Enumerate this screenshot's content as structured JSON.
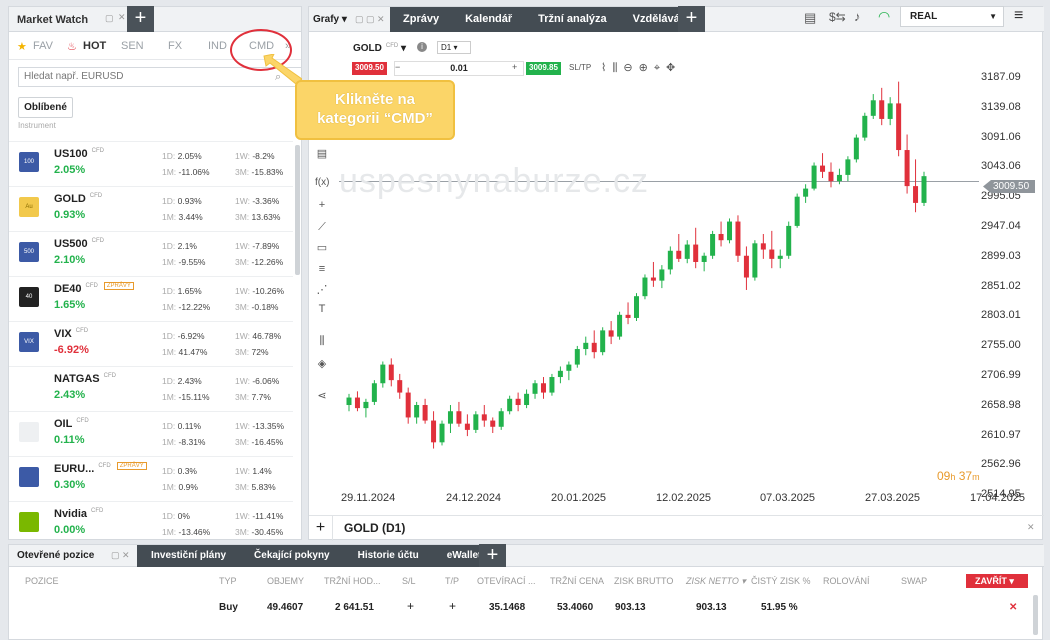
{
  "market_watch": {
    "title": "Market Watch",
    "categories": [
      "FAV",
      "HOT",
      "SEN",
      "FX",
      "IND",
      "CMD"
    ],
    "search_placeholder": "Hledat např. EURUSD",
    "favorites_button": "Oblíbené",
    "instrument_label": "Instrument",
    "cfd_tag": "CFD",
    "rows": [
      {
        "symbol": "US100",
        "change": "2.05%",
        "d1": "2.05%",
        "m1": "-11.06%",
        "w1": "-8.2%",
        "m3": "-15.83%",
        "badge": "",
        "flag_text": "100",
        "dir": "pos"
      },
      {
        "symbol": "GOLD",
        "change": "0.93%",
        "d1": "0.93%",
        "m1": "3.44%",
        "w1": "-3.36%",
        "m3": "13.63%",
        "badge": "",
        "flag_text": "Au",
        "dir": "pos"
      },
      {
        "symbol": "US500",
        "change": "2.10%",
        "d1": "2.1%",
        "m1": "-9.55%",
        "w1": "-7.89%",
        "m3": "-12.26%",
        "badge": "",
        "flag_text": "500",
        "dir": "pos"
      },
      {
        "symbol": "DE40",
        "change": "1.65%",
        "d1": "1.65%",
        "m1": "-12.22%",
        "w1": "-10.26%",
        "m3": "-0.18%",
        "badge": "ZPRÁVY",
        "flag_text": "40",
        "dir": "pos"
      },
      {
        "symbol": "VIX",
        "change": "-6.92%",
        "d1": "-6.92%",
        "m1": "41.47%",
        "w1": "46.78%",
        "m3": "72%",
        "badge": "",
        "flag_text": "VIX",
        "dir": "neg"
      },
      {
        "symbol": "NATGAS",
        "change": "2.43%",
        "d1": "2.43%",
        "m1": "-15.11%",
        "w1": "-6.06%",
        "m3": "7.7%",
        "badge": "",
        "flag_text": "",
        "dir": "pos"
      },
      {
        "symbol": "OIL",
        "change": "0.11%",
        "d1": "0.11%",
        "m1": "-8.31%",
        "w1": "-13.35%",
        "m3": "-16.45%",
        "badge": "",
        "flag_text": "",
        "dir": "pos"
      },
      {
        "symbol": "EURU...",
        "change": "0.30%",
        "d1": "0.3%",
        "m1": "0.9%",
        "w1": "1.4%",
        "m3": "5.83%",
        "badge": "ZPRÁVY",
        "flag_text": "",
        "dir": "pos"
      },
      {
        "symbol": "Nvidia",
        "change": "0.00%",
        "d1": "0%",
        "m1": "-13.46%",
        "w1": "-11.41%",
        "m3": "-30.45%",
        "badge": "",
        "flag_text": "",
        "dir": "pos"
      }
    ],
    "stat_labels": {
      "d1": "1D:",
      "m1": "1M:",
      "w1": "1W:",
      "m3": "3M:"
    }
  },
  "chart_panel": {
    "tab_grafy": "Grafy",
    "tabs": [
      "Zprávy",
      "Kalendář",
      "Tržní analýza",
      "Vzdělávání"
    ],
    "symbol": "GOLD",
    "timeframe": "D1",
    "sell_price": "3009.50",
    "buy_price": "3009.85",
    "volume": "0.01",
    "sltp": "SL/TP",
    "watermark": "uspesnynaburze.cz",
    "current_price_label": "3009.50",
    "countdown_h": "09",
    "countdown_m": "37",
    "bottom_title": "GOLD (D1)",
    "price_axis": [
      "3187.09",
      "3139.08",
      "3091.06",
      "3043.06",
      "2995.05",
      "2947.04",
      "2899.03",
      "2851.02",
      "2803.01",
      "2755.00",
      "2706.99",
      "2658.98",
      "2610.97",
      "2562.96",
      "2514.95"
    ],
    "date_axis": [
      "29.11.2024",
      "24.12.2024",
      "20.01.2025",
      "12.02.2025",
      "07.03.2025",
      "27.03.2025",
      "17.04.2025"
    ]
  },
  "account": {
    "mode": "REAL"
  },
  "callout": {
    "line1": "Klikněte na",
    "line2": "kategorii “CMD”"
  },
  "bottom_panel": {
    "title": "Otevřené pozice",
    "tabs": [
      "Investiční plány",
      "Čekající pokyny",
      "Historie účtu",
      "eWallet"
    ],
    "columns": [
      "POZICE",
      "TYP",
      "OBJEMY",
      "TRŽNÍ HOD...",
      "S/L",
      "T/P",
      "OTEVÍRACÍ ...",
      "TRŽNÍ CENA",
      "ZISK BRUTTO",
      "ZISK NETTO",
      "ČISTÝ ZISK %",
      "ROLOVÁNÍ",
      "SWAP"
    ],
    "close_button": "ZAVŘÍT",
    "row": {
      "typ": "Buy",
      "objem": "49.4607",
      "trzni_hodnota": "2 641.51",
      "sl": "+",
      "tp": "+",
      "oteviraci": "35.1468",
      "trzni_cena": "53.4060",
      "zisk_brutto": "903.13",
      "zisk_netto": "903.13",
      "cisty_zisk": "51.95 %"
    }
  },
  "chart_data": {
    "type": "candlestick",
    "symbol": "GOLD",
    "timeframe": "D1",
    "ylim": [
      2514.95,
      3187.09
    ],
    "x_labels": [
      "29.11.2024",
      "24.12.2024",
      "20.01.2025",
      "12.02.2025",
      "07.03.2025",
      "27.03.2025",
      "17.04.2025"
    ],
    "last_price": 3009.5,
    "candles": [
      [
        2650,
        2668,
        2640,
        2662
      ],
      [
        2662,
        2672,
        2640,
        2645
      ],
      [
        2645,
        2660,
        2630,
        2655
      ],
      [
        2655,
        2690,
        2650,
        2685
      ],
      [
        2685,
        2720,
        2678,
        2715
      ],
      [
        2715,
        2725,
        2680,
        2690
      ],
      [
        2690,
        2700,
        2660,
        2670
      ],
      [
        2670,
        2678,
        2620,
        2630
      ],
      [
        2630,
        2655,
        2620,
        2650
      ],
      [
        2650,
        2660,
        2620,
        2625
      ],
      [
        2625,
        2640,
        2580,
        2590
      ],
      [
        2590,
        2625,
        2585,
        2620
      ],
      [
        2620,
        2650,
        2605,
        2640
      ],
      [
        2640,
        2655,
        2615,
        2620
      ],
      [
        2620,
        2635,
        2600,
        2610
      ],
      [
        2610,
        2640,
        2605,
        2635
      ],
      [
        2635,
        2650,
        2615,
        2625
      ],
      [
        2625,
        2630,
        2605,
        2615
      ],
      [
        2615,
        2645,
        2610,
        2640
      ],
      [
        2640,
        2665,
        2635,
        2660
      ],
      [
        2660,
        2670,
        2640,
        2650
      ],
      [
        2650,
        2675,
        2645,
        2668
      ],
      [
        2668,
        2690,
        2660,
        2685
      ],
      [
        2685,
        2695,
        2660,
        2670
      ],
      [
        2670,
        2700,
        2665,
        2695
      ],
      [
        2695,
        2712,
        2685,
        2705
      ],
      [
        2705,
        2720,
        2690,
        2715
      ],
      [
        2715,
        2745,
        2710,
        2740
      ],
      [
        2740,
        2760,
        2730,
        2750
      ],
      [
        2750,
        2770,
        2725,
        2735
      ],
      [
        2735,
        2775,
        2730,
        2770
      ],
      [
        2770,
        2785,
        2748,
        2760
      ],
      [
        2760,
        2800,
        2755,
        2795
      ],
      [
        2795,
        2815,
        2780,
        2790
      ],
      [
        2790,
        2830,
        2785,
        2825
      ],
      [
        2825,
        2860,
        2820,
        2855
      ],
      [
        2855,
        2880,
        2840,
        2850
      ],
      [
        2850,
        2875,
        2838,
        2868
      ],
      [
        2868,
        2905,
        2860,
        2898
      ],
      [
        2898,
        2925,
        2880,
        2885
      ],
      [
        2885,
        2915,
        2878,
        2908
      ],
      [
        2908,
        2935,
        2870,
        2880
      ],
      [
        2880,
        2895,
        2865,
        2890
      ],
      [
        2890,
        2930,
        2885,
        2925
      ],
      [
        2925,
        2945,
        2905,
        2915
      ],
      [
        2915,
        2950,
        2910,
        2945
      ],
      [
        2945,
        2955,
        2880,
        2890
      ],
      [
        2890,
        2905,
        2835,
        2855
      ],
      [
        2855,
        2915,
        2850,
        2910
      ],
      [
        2910,
        2925,
        2885,
        2900
      ],
      [
        2900,
        2930,
        2870,
        2885
      ],
      [
        2885,
        2900,
        2870,
        2890
      ],
      [
        2890,
        2945,
        2885,
        2938
      ],
      [
        2938,
        2990,
        2935,
        2985
      ],
      [
        2985,
        3005,
        2975,
        2998
      ],
      [
        2998,
        3040,
        2995,
        3035
      ],
      [
        3035,
        3055,
        3015,
        3025
      ],
      [
        3025,
        3040,
        3000,
        3010
      ],
      [
        3010,
        3030,
        3005,
        3020
      ],
      [
        3020,
        3050,
        3010,
        3045
      ],
      [
        3045,
        3085,
        3040,
        3080
      ],
      [
        3080,
        3120,
        3075,
        3115
      ],
      [
        3115,
        3150,
        3110,
        3140
      ],
      [
        3140,
        3160,
        3100,
        3110
      ],
      [
        3110,
        3145,
        3100,
        3135
      ],
      [
        3135,
        3170,
        3050,
        3060
      ],
      [
        3060,
        3085,
        2990,
        3002
      ],
      [
        3002,
        3045,
        2960,
        2975
      ],
      [
        2975,
        3025,
        2970,
        3018
      ]
    ]
  }
}
